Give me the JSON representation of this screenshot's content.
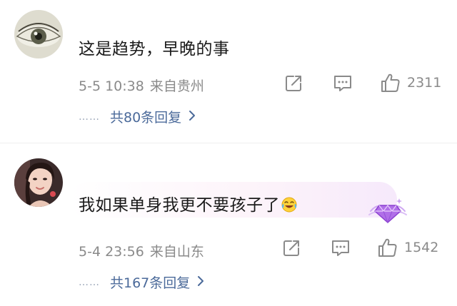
{
  "comments": [
    {
      "text": "这是趋势，早晚的事",
      "date": "5-5 10:38",
      "location": "来自贵州",
      "likes": "2311",
      "replies_label": "共80条回复",
      "replies_dots": "……"
    },
    {
      "text": "我如果单身我更不要孩子了",
      "date": "5-4 23:56",
      "location": "来自山东",
      "likes": "1542",
      "replies_label": "共167条回复",
      "replies_dots": "……"
    }
  ],
  "icons": {
    "share": "share-icon",
    "comment": "comment-icon",
    "like": "thumbs-up-icon",
    "chevron": "chevron-right-icon",
    "emoji": "laughing-crying-emoji-icon",
    "badge": "purple-gem-badge-icon"
  },
  "colors": {
    "text": "#1a1a1a",
    "meta": "#8a8a8a",
    "reply_link": "#4b6a9a",
    "badge": "#b06ee8"
  }
}
